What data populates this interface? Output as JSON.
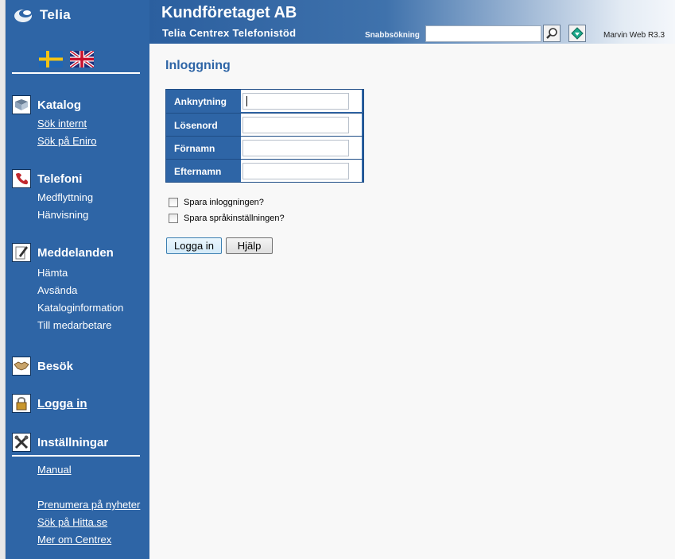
{
  "brand": {
    "logo_text": "Telia"
  },
  "header": {
    "company": "Kundföretaget AB",
    "subtitle": "Telia Centrex Telefonistöd",
    "search_label": "Snabbsökning",
    "search_value": "",
    "version": "Marvin Web R3.3"
  },
  "sidebar": {
    "flags": [
      {
        "name": "swedish-flag"
      },
      {
        "name": "uk-flag"
      }
    ],
    "katalog": {
      "title": "Katalog",
      "links": [
        "Sök internt",
        "Sök på Eniro"
      ]
    },
    "telefoni": {
      "title": "Telefoni",
      "links": [
        "Medflyttning",
        "Hänvisning"
      ]
    },
    "meddelanden": {
      "title": "Meddelanden",
      "links": [
        "Hämta",
        "Avsända",
        "Kataloginformation",
        "Till medarbetare"
      ]
    },
    "besok": {
      "title": "Besök"
    },
    "logga_in": {
      "title": "Logga in"
    },
    "installningar": {
      "title": "Inställningar"
    },
    "bottom_links": [
      "Manual",
      "Prenumera på nyheter",
      "Sök på Hitta.se",
      "Mer om Centrex"
    ]
  },
  "main": {
    "title": "Inloggning",
    "fields": [
      {
        "label": "Anknytning",
        "value": ""
      },
      {
        "label": "Lösenord",
        "value": ""
      },
      {
        "label": "Förnamn",
        "value": ""
      },
      {
        "label": "Efternamn",
        "value": ""
      }
    ],
    "checkboxes": [
      {
        "label": "Spara inloggningen?",
        "checked": false
      },
      {
        "label": "Spara språkinställningen?",
        "checked": false
      }
    ],
    "login_button": "Logga in",
    "help_button": "Hjälp"
  },
  "colors": {
    "sidebar": "#2e65a6",
    "accent": "#2e65a6"
  }
}
